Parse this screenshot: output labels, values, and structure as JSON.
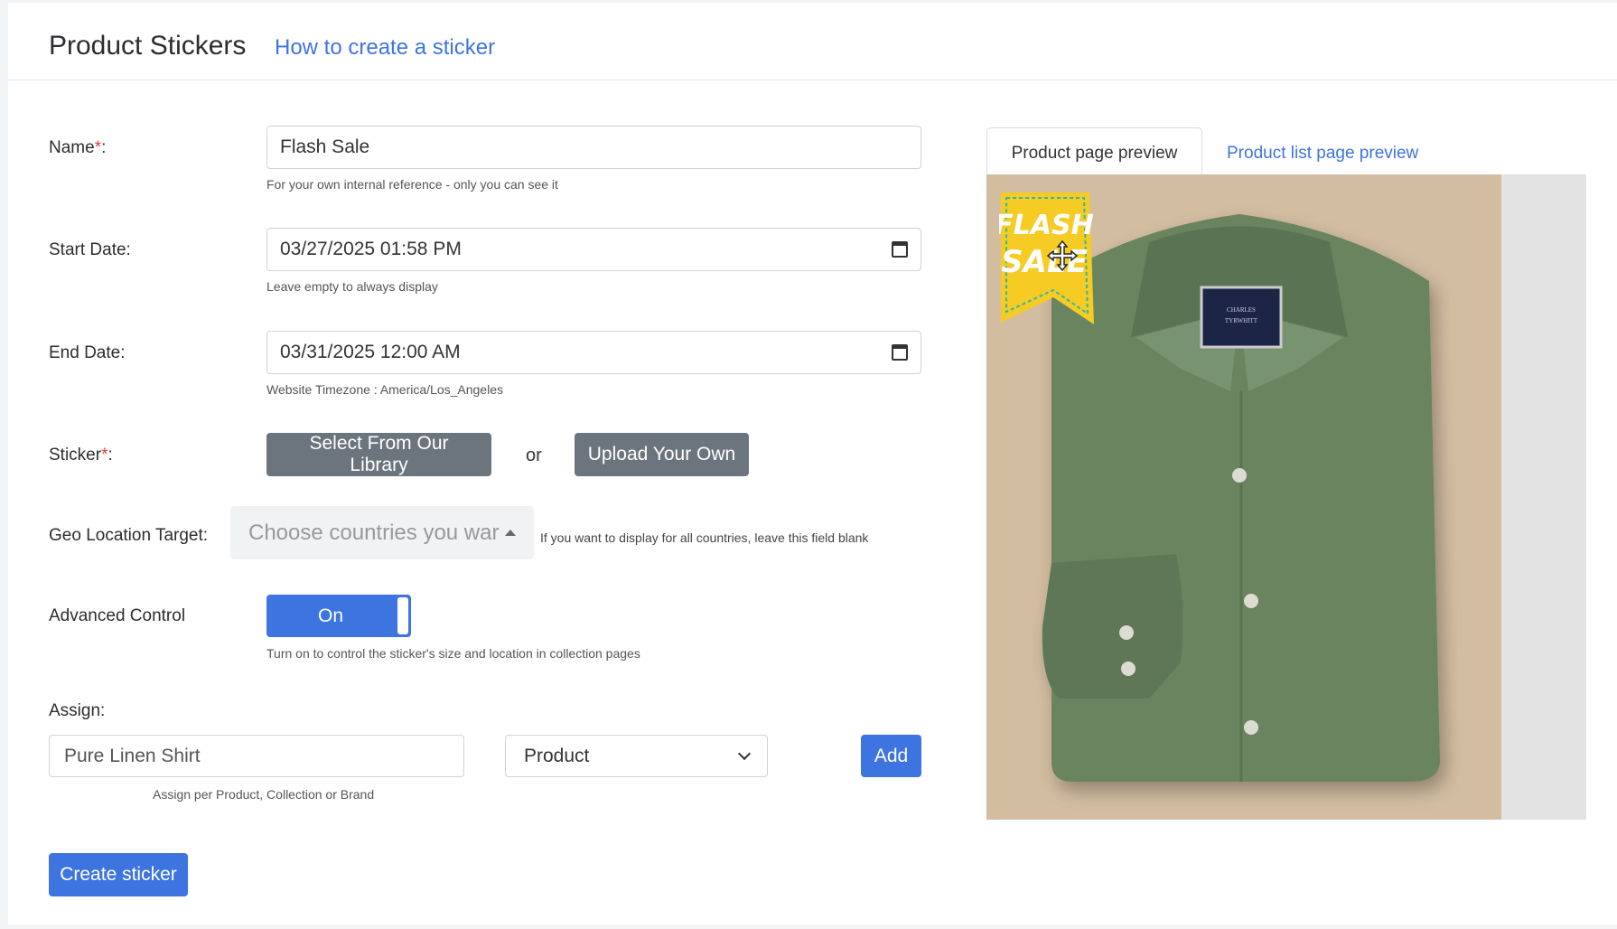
{
  "header": {
    "title": "Product Stickers",
    "help_link": "How to create a sticker"
  },
  "form": {
    "name": {
      "label": "Name",
      "required_mark": "*",
      "suffix": ":",
      "value": "Flash Sale",
      "help": "For your own internal reference - only you can see it"
    },
    "start_date": {
      "label": "Start Date:",
      "value": "03/27/2025 01:58 PM",
      "help": "Leave empty to always display"
    },
    "end_date": {
      "label": "End Date:",
      "value": "03/31/2025 12:00 AM",
      "help": "Website Timezone : America/Los_Angeles"
    },
    "sticker": {
      "label": "Sticker",
      "required_mark": "*",
      "suffix": ":",
      "library_button": "Select From Our Library",
      "or_text": "or",
      "upload_button": "Upload Your Own"
    },
    "geo": {
      "label": "Geo Location Target:",
      "placeholder": "Choose countries you war",
      "help": "If you want to display for all countries, leave this field blank"
    },
    "advanced": {
      "label": "Advanced Control",
      "toggle_state": "On",
      "help": "Turn on to control the sticker's size and location in collection pages"
    },
    "assign": {
      "label": "Assign:",
      "search_value": "Pure Linen Shirt",
      "type_selected": "Product",
      "add_button": "Add",
      "help": "Assign per Product, Collection or Brand"
    },
    "submit_button": "Create sticker"
  },
  "preview": {
    "tabs": [
      {
        "label": "Product page preview",
        "active": true
      },
      {
        "label": "Product list page preview",
        "active": false
      }
    ],
    "sticker_text": [
      "FLASH",
      "SALE"
    ],
    "shirt_label": [
      "CHARLES",
      "TYRWHITT"
    ],
    "colors": {
      "background": "#d3bda1",
      "shirt": "#6b8461",
      "sticker": "#f6cb23",
      "accent": "#3d74e0"
    }
  }
}
